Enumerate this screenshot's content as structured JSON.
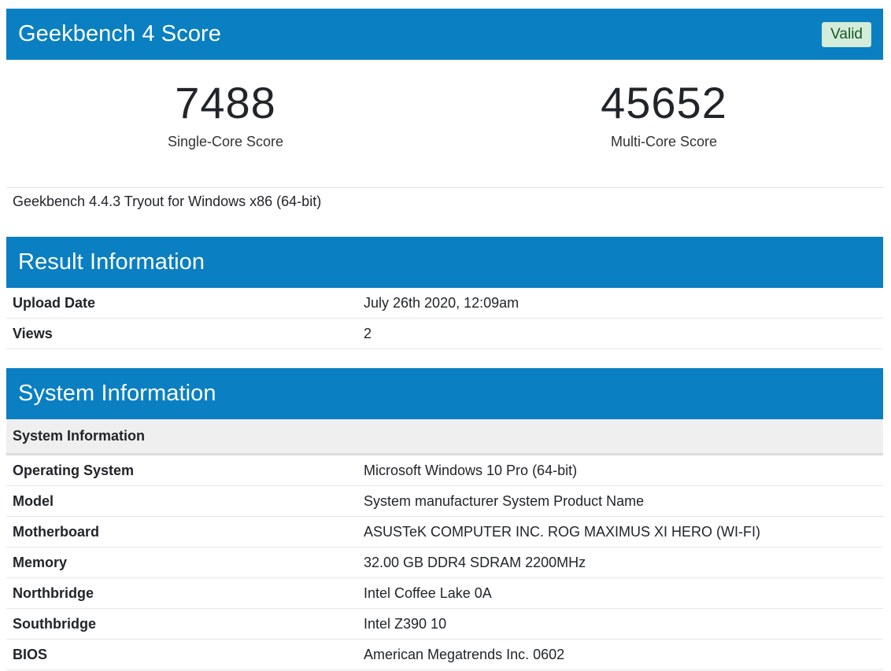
{
  "score_card": {
    "title": "Geekbench 4 Score",
    "badge": "Valid",
    "single_core": {
      "value": "7488",
      "label": "Single-Core Score"
    },
    "multi_core": {
      "value": "45652",
      "label": "Multi-Core Score"
    },
    "version": "Geekbench 4.4.3 Tryout for Windows x86 (64-bit)"
  },
  "result_info": {
    "title": "Result Information",
    "rows": [
      {
        "name": "Upload Date",
        "value": "July 26th 2020, 12:09am"
      },
      {
        "name": "Views",
        "value": "2"
      }
    ]
  },
  "system_info": {
    "title": "System Information",
    "subheader": "System Information",
    "rows": [
      {
        "name": "Operating System",
        "value": "Microsoft Windows 10 Pro (64-bit)"
      },
      {
        "name": "Model",
        "value": "System manufacturer System Product Name"
      },
      {
        "name": "Motherboard",
        "value": "ASUSTeK COMPUTER INC. ROG MAXIMUS XI HERO (WI-FI)"
      },
      {
        "name": "Memory",
        "value": "32.00 GB DDR4 SDRAM 2200MHz"
      },
      {
        "name": "Northbridge",
        "value": "Intel Coffee Lake 0A"
      },
      {
        "name": "Southbridge",
        "value": "Intel Z390 10"
      },
      {
        "name": "BIOS",
        "value": "American Megatrends Inc. 0602"
      }
    ]
  },
  "colors": {
    "header_blue": "#0a7fc2",
    "valid_bg": "#d4edda",
    "valid_text": "#155724"
  }
}
